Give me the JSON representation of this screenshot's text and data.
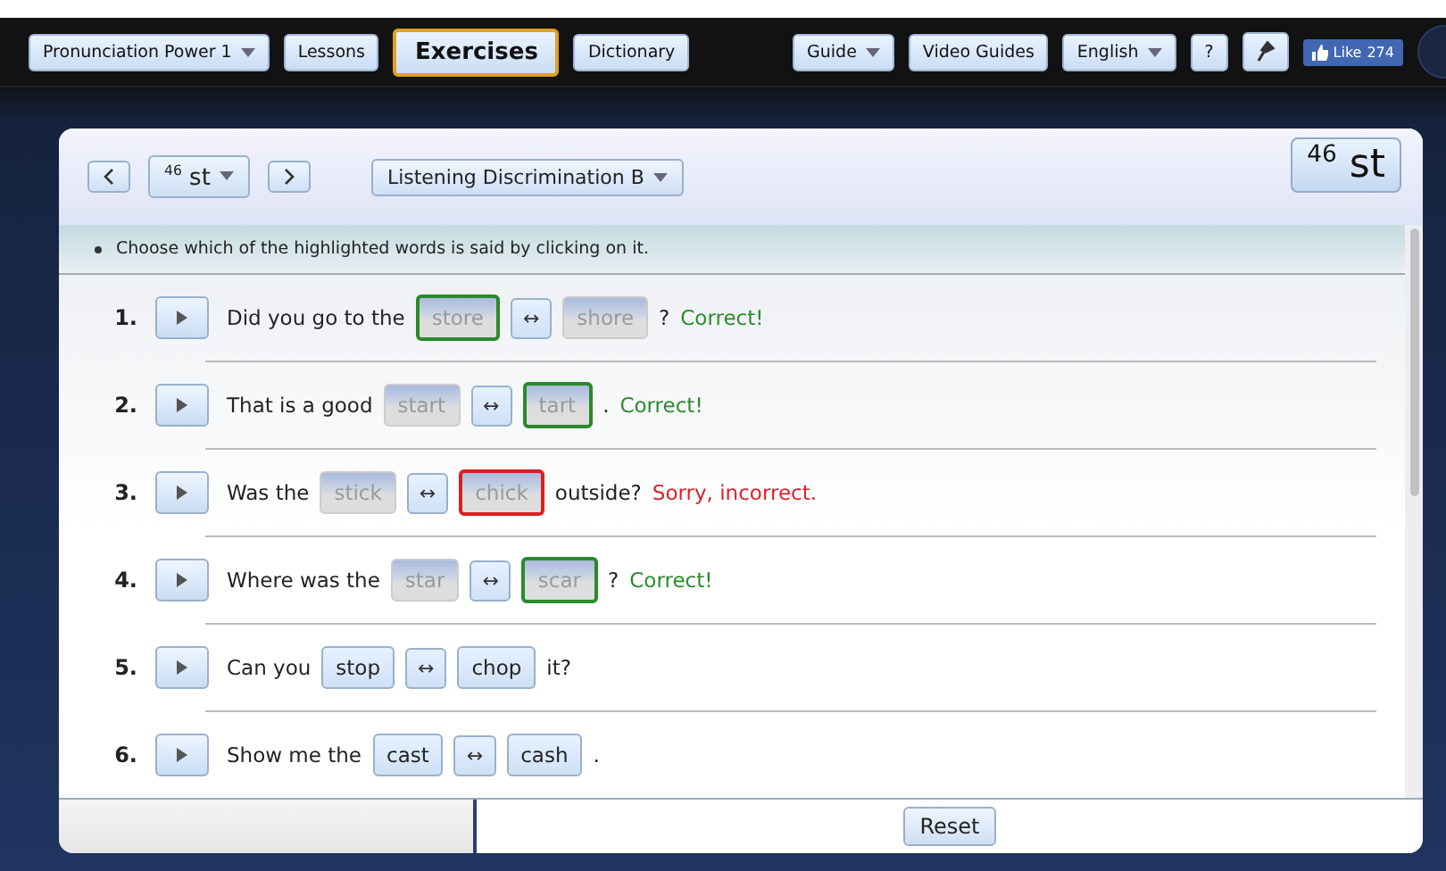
{
  "nav": {
    "left": [
      {
        "label": "Pronunciation Power 1",
        "dropdown": true,
        "selected": false
      },
      {
        "label": "Lessons",
        "dropdown": false,
        "selected": false
      },
      {
        "label": "Exercises",
        "dropdown": false,
        "selected": true
      },
      {
        "label": "Dictionary",
        "dropdown": false,
        "selected": false
      }
    ],
    "right": [
      {
        "label": "Guide",
        "dropdown": true
      },
      {
        "label": "Video Guides",
        "dropdown": false
      },
      {
        "label": "English",
        "dropdown": true
      },
      {
        "label": "?",
        "dropdown": false
      }
    ],
    "like": {
      "label": "Like",
      "count": "274"
    }
  },
  "header": {
    "sound_select": "$^{46}$ st",
    "exercise_select": "Listening Discrimination B",
    "sound_badge": "$^{46}$ st"
  },
  "instruction": "Choose which of the highlighted words is said by clicking on it.",
  "items": [
    {
      "number": "1.",
      "before": "Did you go to the",
      "choices": [
        {
          "text": "store",
          "selected": true,
          "disabled": true
        },
        {
          "text": "shore",
          "selected": false,
          "disabled": true
        }
      ],
      "after": "?",
      "feedback": {
        "text": "Correct!",
        "kind": "correct"
      }
    },
    {
      "number": "2.",
      "before": "That is a good",
      "choices": [
        {
          "text": "start",
          "selected": false,
          "disabled": true
        },
        {
          "text": "tart",
          "selected": true,
          "disabled": true
        }
      ],
      "after": ".",
      "feedback": {
        "text": "Correct!",
        "kind": "correct"
      }
    },
    {
      "number": "3.",
      "before": "Was the",
      "choices": [
        {
          "text": "stick",
          "selected": false,
          "disabled": true
        },
        {
          "text": "chick",
          "selected": true,
          "disabled": true
        }
      ],
      "after": "outside?",
      "feedback": {
        "text": "Sorry, incorrect.",
        "kind": "incorrect"
      }
    },
    {
      "number": "4.",
      "before": "Where was the",
      "choices": [
        {
          "text": "star",
          "selected": false,
          "disabled": true
        },
        {
          "text": "scar",
          "selected": true,
          "disabled": true
        }
      ],
      "after": "?",
      "feedback": {
        "text": "Correct!",
        "kind": "correct"
      }
    },
    {
      "number": "5.",
      "before": "Can you",
      "choices": [
        {
          "text": "stop",
          "selected": false,
          "disabled": false
        },
        {
          "text": "chop",
          "selected": false,
          "disabled": false
        }
      ],
      "after": "it?"
    },
    {
      "number": "6.",
      "before": "Show me the",
      "choices": [
        {
          "text": "cast",
          "selected": false,
          "disabled": false
        },
        {
          "text": "cash",
          "selected": false,
          "disabled": false
        }
      ],
      "after": "."
    }
  ],
  "swap_symbol": "↔",
  "footer": {
    "reset": "Reset"
  }
}
